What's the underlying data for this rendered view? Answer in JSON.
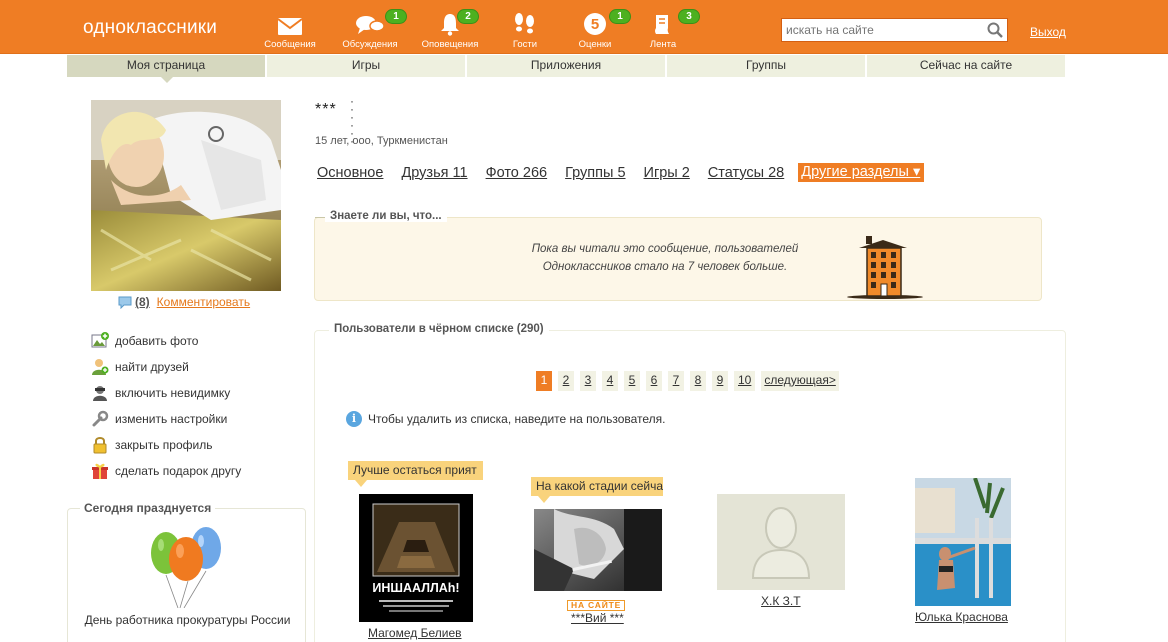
{
  "header": {
    "logo": "одноклассники",
    "nav": [
      {
        "label": "Сообщения",
        "icon": "envelope-icon",
        "badge": ""
      },
      {
        "label": "Обсуждения",
        "icon": "chat-bubbles-icon",
        "badge": "1"
      },
      {
        "label": "Оповещения",
        "icon": "bell-icon",
        "badge": "2"
      },
      {
        "label": "Гости",
        "icon": "footprints-icon",
        "badge": ""
      },
      {
        "label": "Оценки",
        "icon": "rating-five-icon",
        "badge": "1",
        "value": "5"
      },
      {
        "label": "Лента",
        "icon": "feed-icon",
        "badge": "3"
      }
    ],
    "search_placeholder": "искать на сайте",
    "logout": "Выход",
    "accent": "#ef7d24"
  },
  "tabs": [
    "Моя страница",
    "Игры",
    "Приложения",
    "Группы",
    "Сейчас на сайте"
  ],
  "profile": {
    "name": "***",
    "dots": "· · ·\n· · ·",
    "info": "15 лет, ооо, Туркменистан",
    "comment_count": "(8)",
    "comment_link": "Комментировать",
    "sections": [
      "Основное",
      "Друзья 11",
      "Фото 266",
      "Группы 5",
      "Игры 2",
      "Статусы 28"
    ],
    "more_sections": "Другие разделы ▾"
  },
  "actions": [
    {
      "label": "добавить фото",
      "icon": "add-photo-icon"
    },
    {
      "label": "найти друзей",
      "icon": "find-friends-icon"
    },
    {
      "label": "включить невидимку",
      "icon": "invisible-icon"
    },
    {
      "label": "изменить настройки",
      "icon": "wrench-icon"
    },
    {
      "label": "закрыть профиль",
      "icon": "lock-icon"
    },
    {
      "label": "сделать подарок другу",
      "icon": "gift-icon"
    }
  ],
  "holiday": {
    "title": "Сегодня празднуется",
    "name": "День работника прокуратуры России"
  },
  "did_you_know": {
    "title": "Знаете ли вы, что...",
    "line1": "Пока вы читали это сообщение, пользователей",
    "line2": "Одноклассников стало на 7 человек больше."
  },
  "blacklist": {
    "title": "Пользователи в чёрном списке (290)",
    "pages": [
      "1",
      "2",
      "3",
      "4",
      "5",
      "6",
      "7",
      "8",
      "9",
      "10"
    ],
    "current_page": "1",
    "next": "следующая>",
    "hint": "Чтобы удалить из списка, наведите на пользователя.",
    "users": [
      {
        "name": "Магомед Белиев",
        "status": "Лучше остаться прият",
        "photo_text": "ИНШААЛЛАh!",
        "online": ""
      },
      {
        "name": "***Вий ***",
        "status": "На какой стадии сейча",
        "online": "НА САЙТЕ"
      },
      {
        "name": "Х.К З.Т",
        "status": "",
        "online": ""
      },
      {
        "name": "Юлька Краснова",
        "status": "",
        "online": ""
      }
    ]
  }
}
